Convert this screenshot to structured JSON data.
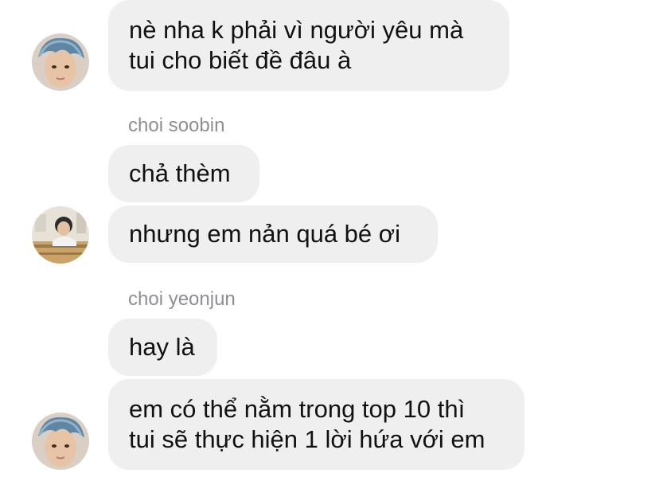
{
  "messages": [
    {
      "lines": [
        "nè nha k phải vì người yêu mà",
        "tui cho biết đề đâu à"
      ]
    },
    {
      "sender": "choi soobin",
      "bubbles": [
        "chả thèm",
        "nhưng em nản quá bé ơi"
      ]
    },
    {
      "sender": "choi yeonjun",
      "bubbles": [
        "hay là"
      ],
      "lines": [
        "em có thể nằm trong top 10 thì",
        "tui sẽ thực hiện 1 lời hứa với em"
      ]
    }
  ],
  "avatars": [
    {
      "icon": "blue-hair-avatar",
      "color": "#6a8fa8"
    },
    {
      "icon": "photo-avatar",
      "color": "#b49a6a"
    },
    {
      "icon": "blue-hair-avatar",
      "color": "#6a8fa8"
    }
  ]
}
